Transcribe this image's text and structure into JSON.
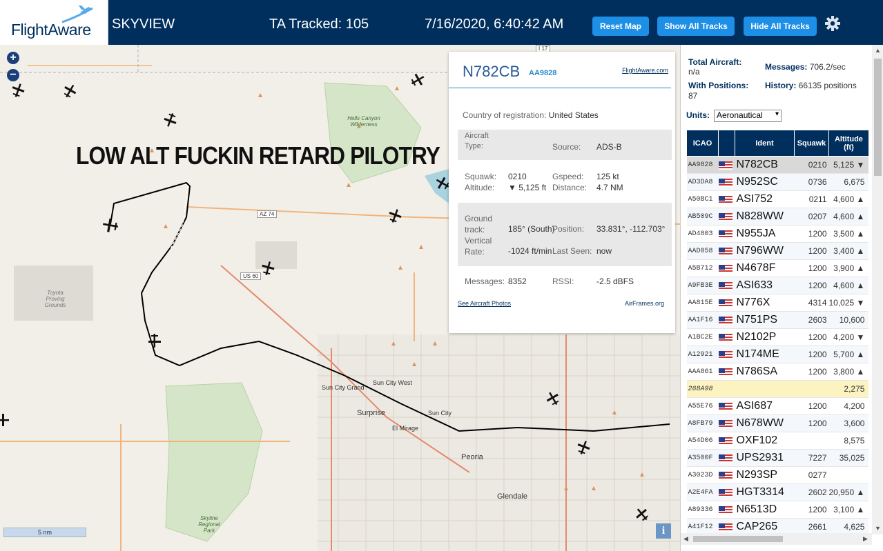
{
  "header": {
    "logo": "FlightAware",
    "title": "SKYVIEW",
    "tracked": "TA Tracked: 105",
    "datetime": "7/16/2020, 6:40:42 AM",
    "buttons": {
      "reset": "Reset Map",
      "show_all": "Show All Tracks",
      "hide_all": "Hide All Tracks"
    },
    "settings_icon": "gear-icon"
  },
  "map": {
    "overlay_text": "LOW ALT FUCKIN RETARD PILOTRY",
    "scale_label": "5 nm",
    "labels": [
      "Hells Canyon Wilderness",
      "Toyota Proving Grounds",
      "Sun City West",
      "Sun City Grand",
      "Surprise",
      "Sun City",
      "El Mirage",
      "Peoria",
      "Glendale",
      "Skyline Regional Park",
      "AZ 74",
      "US 60",
      "I 17"
    ],
    "zoom_in": "+",
    "zoom_out": "−",
    "info_icon": "i"
  },
  "popup": {
    "ident": "N782CB",
    "flight": "AA9828",
    "link_fa": "FlightAware.com",
    "country_label": "Country of registration:",
    "country_value": "United States",
    "aircraft_type_label": "Aircraft Type:",
    "source_label": "Source:",
    "source_value": "ADS-B",
    "squawk_label": "Squawk:",
    "squawk_value": "0210",
    "gspeed_label": "Gspeed:",
    "gspeed_value": "125 kt",
    "altitude_label": "Altitude:",
    "altitude_value": "▼ 5,125 ft",
    "distance_label": "Distance:",
    "distance_value": "4.7 NM",
    "ground_track_label": "Ground track:",
    "ground_track_value": "185° (South)",
    "position_label": "Position:",
    "position_value": "33.831°, -112.703°",
    "vertical_rate_label": "Vertical Rate:",
    "vertical_rate_value": "-1024 ft/min",
    "last_seen_label": "Last Seen:",
    "last_seen_value": "now",
    "messages_label": "Messages:",
    "messages_value": "8352",
    "rssi_label": "RSSI:",
    "rssi_value": "-2.5 dBFS",
    "photos_link": "See Aircraft Photos",
    "airframes_link": "AirFrames.org"
  },
  "panel": {
    "total_aircraft_label": "Total Aircraft:",
    "total_aircraft_value": "n/a",
    "messages_label": "Messages:",
    "messages_value": "706.2/sec",
    "with_positions_label": "With Positions:",
    "with_positions_value": "87",
    "history_label": "History:",
    "history_value": "66135 positions",
    "units_label": "Units:",
    "units_value": "Aeronautical",
    "columns": [
      "ICAO",
      "",
      "Ident",
      "Squawk",
      "Altitude (ft)"
    ],
    "rows": [
      {
        "icao": "AA9828",
        "flag": true,
        "ident": "N782CB",
        "squawk": "0210",
        "alt": "5,125 ▼",
        "state": "sel"
      },
      {
        "icao": "AD3DA8",
        "flag": true,
        "ident": "N952SC",
        "squawk": "0736",
        "alt": "6,675",
        "state": ""
      },
      {
        "icao": "A50BC1",
        "flag": true,
        "ident": "ASI752",
        "squawk": "0211",
        "alt": "4,600 ▲",
        "state": ""
      },
      {
        "icao": "AB509C",
        "flag": true,
        "ident": "N828WW",
        "squawk": "0207",
        "alt": "4,600 ▲",
        "state": ""
      },
      {
        "icao": "AD4803",
        "flag": true,
        "ident": "N955JA",
        "squawk": "1200",
        "alt": "3,500 ▲",
        "state": ""
      },
      {
        "icao": "AAD058",
        "flag": true,
        "ident": "N796WW",
        "squawk": "1200",
        "alt": "3,400 ▲",
        "state": ""
      },
      {
        "icao": "A5B712",
        "flag": true,
        "ident": "N4678F",
        "squawk": "1200",
        "alt": "3,900 ▲",
        "state": ""
      },
      {
        "icao": "A9FB3E",
        "flag": true,
        "ident": "ASI633",
        "squawk": "1200",
        "alt": "4,600 ▲",
        "state": ""
      },
      {
        "icao": "AA815E",
        "flag": true,
        "ident": "N776X",
        "squawk": "4314",
        "alt": "10,025 ▼",
        "state": ""
      },
      {
        "icao": "AA1F16",
        "flag": true,
        "ident": "N751PS",
        "squawk": "2603",
        "alt": "10,600",
        "state": ""
      },
      {
        "icao": "A1BC2E",
        "flag": true,
        "ident": "N2102P",
        "squawk": "1200",
        "alt": "4,200 ▼",
        "state": ""
      },
      {
        "icao": "A12921",
        "flag": true,
        "ident": "N174ME",
        "squawk": "1200",
        "alt": "5,700 ▲",
        "state": ""
      },
      {
        "icao": "AAA861",
        "flag": true,
        "ident": "N786SA",
        "squawk": "1200",
        "alt": "3,800 ▲",
        "state": ""
      },
      {
        "icao": "268A98",
        "flag": false,
        "ident": "",
        "squawk": "",
        "alt": "2,275",
        "state": "hl"
      },
      {
        "icao": "A55E76",
        "flag": true,
        "ident": "ASI687",
        "squawk": "1200",
        "alt": "4,200",
        "state": ""
      },
      {
        "icao": "A8FB79",
        "flag": true,
        "ident": "N678WW",
        "squawk": "1200",
        "alt": "3,600",
        "state": ""
      },
      {
        "icao": "A54D06",
        "flag": true,
        "ident": "OXF102",
        "squawk": "",
        "alt": "8,575",
        "state": ""
      },
      {
        "icao": "A3500F",
        "flag": true,
        "ident": "UPS2931",
        "squawk": "7227",
        "alt": "35,025",
        "state": ""
      },
      {
        "icao": "A3023D",
        "flag": true,
        "ident": "N293SP",
        "squawk": "0277",
        "alt": "",
        "state": ""
      },
      {
        "icao": "A2E4FA",
        "flag": true,
        "ident": "HGT3314",
        "squawk": "2602",
        "alt": "20,950 ▲",
        "state": ""
      },
      {
        "icao": "A89336",
        "flag": true,
        "ident": "N6513D",
        "squawk": "1200",
        "alt": "3,100 ▲",
        "state": ""
      },
      {
        "icao": "A41F12",
        "flag": true,
        "ident": "CAP265",
        "squawk": "2661",
        "alt": "4,625",
        "state": ""
      }
    ]
  }
}
